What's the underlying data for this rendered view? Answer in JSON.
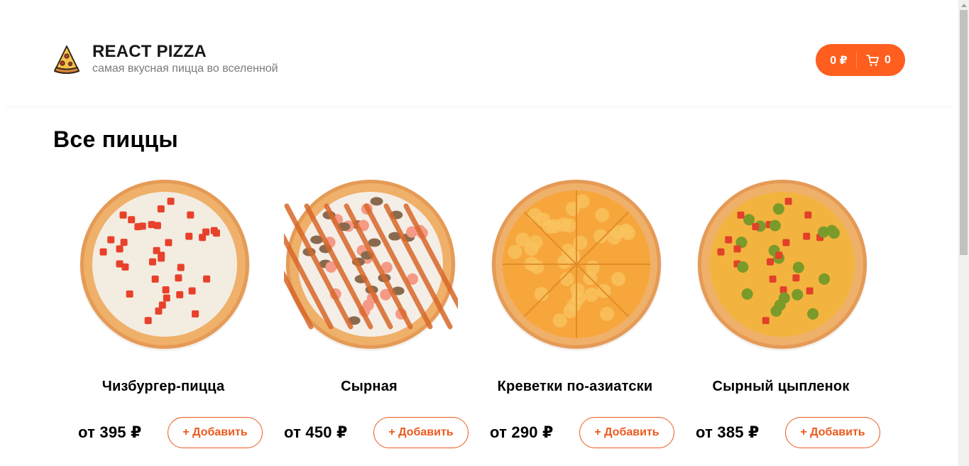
{
  "header": {
    "brand": "REACT PIZZA",
    "tagline": "самая вкусная пицца во вселенной",
    "logo_icon": "pizza-slice-icon",
    "cart": {
      "total": "0 ₽",
      "count": "0",
      "icon": "cart-icon",
      "accent": "#fe5f1e"
    }
  },
  "main": {
    "title": "Все пиццы",
    "add_label": "+ Добавить",
    "pizzas": [
      {
        "name": "Чизбургер-пицца",
        "price": "от 395 ₽",
        "topping": "tomato"
      },
      {
        "name": "Сырная",
        "price": "от 450 ₽",
        "topping": "shrimp"
      },
      {
        "name": "Креветки по-азиатски",
        "price": "от 290 ₽",
        "topping": "cheese"
      },
      {
        "name": "Сырный цыпленок",
        "price": "от 385 ₽",
        "topping": "pickle"
      }
    ]
  },
  "colors": {
    "accent": "#fe5f1e",
    "button_border": "#eb5a1e",
    "subtitle": "#7b7b7b"
  }
}
